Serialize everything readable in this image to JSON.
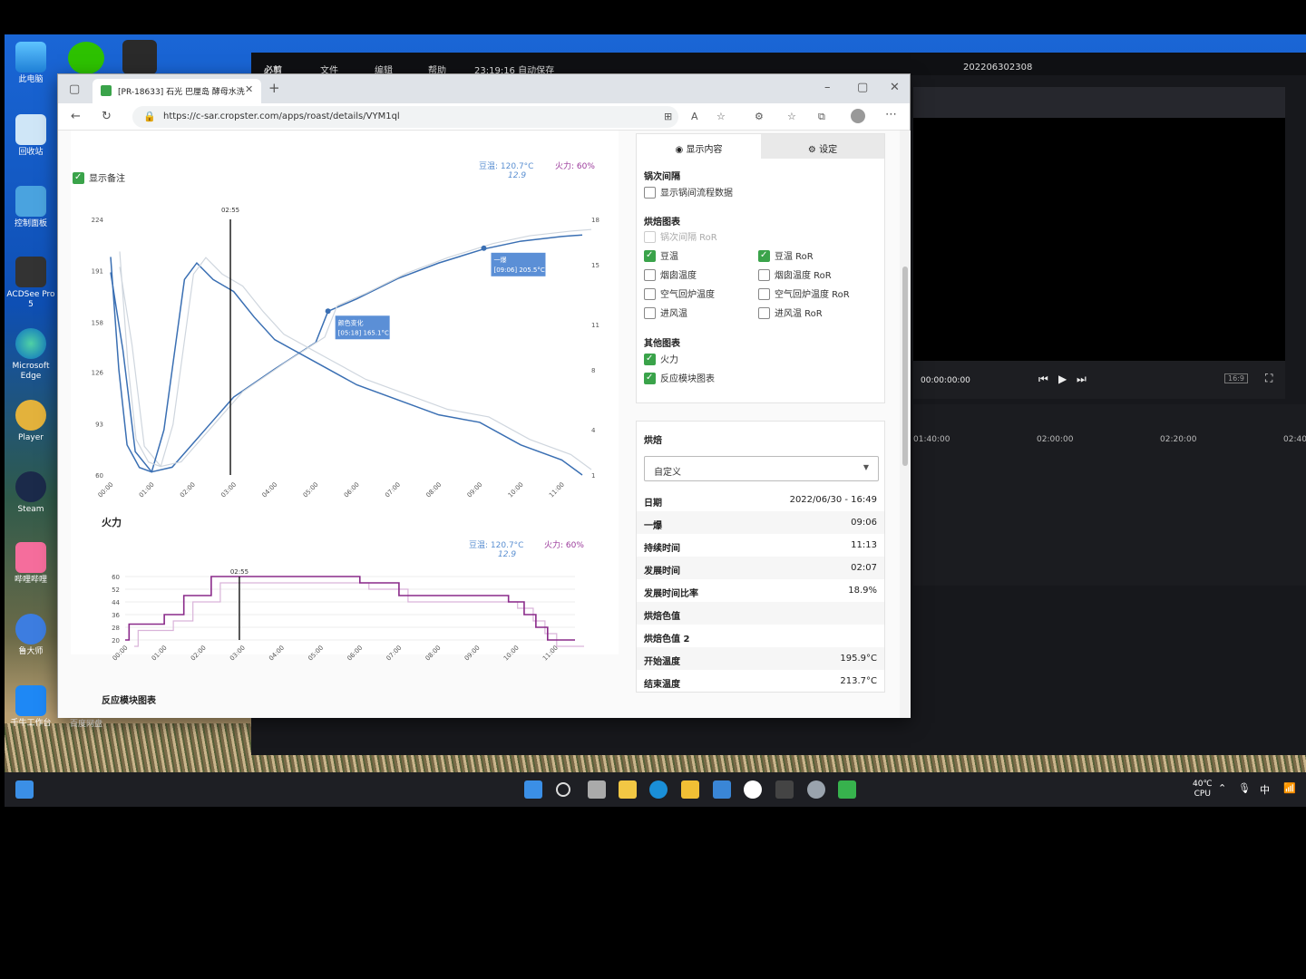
{
  "desktop": {
    "icons": [
      {
        "label": "此电脑"
      },
      {
        "label": "回收站"
      },
      {
        "label": "控制面板"
      },
      {
        "label": "ACDSee Pro 5"
      },
      {
        "label": "Microsoft Edge"
      },
      {
        "label": "Player"
      },
      {
        "label": "Steam"
      },
      {
        "label": "哔哩哔哩"
      },
      {
        "label": "鲁大师"
      },
      {
        "label": "千牛工作台"
      }
    ],
    "extra_label": "百度网盘"
  },
  "editor": {
    "app_name": "必剪",
    "menu": [
      "文件",
      "编辑",
      "帮助"
    ],
    "autosave": "23:19:16 自动保存",
    "project": "202206302308",
    "timecode": "00:00:00:00",
    "aspect": "16:9",
    "ruler": [
      "01:40:00",
      "02:00:00",
      "02:20:00",
      "02:40"
    ]
  },
  "browser": {
    "tab_title": "[PR-18633] 石光 巴厘岛 酵母水洗",
    "url": "https://c-sar.cropster.com/apps/roast/details/VYM1ql"
  },
  "chart_section": {
    "show_notes_label": "显示备注",
    "bt_label": "豆温:",
    "bt_value": "120.7°C",
    "ror_value": "12.9",
    "fire_label": "火力:",
    "fire_value": "60%",
    "fire_title": "火力",
    "reaction_title": "反应模块图表",
    "bt_label2": "豆温:",
    "bt_value2": "120.7°C",
    "ror_value2": "12.9",
    "fire_label2": "火力:",
    "fire_value2": "60%"
  },
  "chart_data": [
    {
      "type": "line",
      "cursor": "02:55",
      "x_ticks": [
        "00:00",
        "01:00",
        "02:00",
        "03:00",
        "04:00",
        "05:00",
        "06:00",
        "07:00",
        "08:00",
        "09:00",
        "10:00",
        "11:00"
      ],
      "y_left_ticks": [
        224,
        191,
        158,
        126,
        93,
        60
      ],
      "y_right_ticks": [
        18,
        15,
        11,
        8,
        4,
        1
      ],
      "ylim": [
        60,
        224
      ],
      "series": [
        {
          "name": "豆温",
          "color": "#3a6fb3",
          "x": [
            0,
            0.3,
            0.6,
            1.0,
            1.5,
            2.0,
            2.5,
            3.0,
            4.0,
            5.0,
            5.3,
            6.0,
            7.0,
            8.0,
            9.1,
            10.0,
            11.0,
            11.5
          ],
          "y": [
            190,
            140,
            75,
            62,
            65,
            80,
            95,
            110,
            128,
            145,
            165,
            173,
            186,
            196,
            205,
            210,
            213,
            214
          ]
        },
        {
          "name": "豆温 RoR",
          "color": "#3a6fb3",
          "axis": "right",
          "x": [
            0,
            0.2,
            0.4,
            0.7,
            1.0,
            1.3,
            1.6,
            1.8,
            2.1,
            2.5,
            3.0,
            3.5,
            4.0,
            5.0,
            6.0,
            7.0,
            8.0,
            9.0,
            10.0,
            11.0,
            11.5
          ],
          "y": [
            15.5,
            8,
            3,
            1.5,
            1.2,
            4,
            10,
            14,
            15.1,
            14,
            13.2,
            11.5,
            10,
            8.5,
            7,
            6,
            5,
            4.5,
            3,
            2,
            1
          ]
        }
      ],
      "annotations": [
        {
          "label": "颜色变化",
          "value": "[05:18] 165.1°C"
        },
        {
          "label": "一爆",
          "value": "[09:06] 205.5°C"
        }
      ]
    },
    {
      "type": "line",
      "cursor": "02:55",
      "x_ticks": [
        "00:00",
        "01:00",
        "02:00",
        "03:00",
        "04:00",
        "05:00",
        "06:00",
        "07:00",
        "08:00",
        "09:00",
        "10:00",
        "11:00"
      ],
      "y_ticks": [
        60,
        52,
        44,
        36,
        28,
        20
      ],
      "ylim": [
        20,
        60
      ],
      "series": [
        {
          "name": "火力",
          "color": "#8a2a8a",
          "x": [
            0,
            0.1,
            0.1,
            1.0,
            1.0,
            1.5,
            1.5,
            2.2,
            2.2,
            6.0,
            6.0,
            7.0,
            7.0,
            9.8,
            9.8,
            10.2,
            10.2,
            10.5,
            10.5,
            10.8,
            10.8,
            11.5
          ],
          "y": [
            20,
            20,
            30,
            30,
            36,
            36,
            48,
            48,
            60,
            60,
            56,
            56,
            48,
            48,
            44,
            44,
            36,
            36,
            28,
            28,
            20,
            20
          ]
        }
      ]
    }
  ],
  "settings": {
    "tab_display": "显示内容",
    "tab_settings": "设定",
    "batch_title": "锅次间隔",
    "batch_show": "显示锅间流程数据",
    "roast_title": "烘焙图表",
    "options": [
      {
        "label": "锅次间隔 RoR",
        "checked": false,
        "disabled": true
      },
      {
        "label": "豆温",
        "checked": true
      },
      {
        "label": "豆温 RoR",
        "checked": true
      },
      {
        "label": "烟囱温度",
        "checked": false
      },
      {
        "label": "烟囱温度 RoR",
        "checked": false
      },
      {
        "label": "空气回炉温度",
        "checked": false
      },
      {
        "label": "空气回炉温度 RoR",
        "checked": false
      },
      {
        "label": "进风温",
        "checked": false
      },
      {
        "label": "进风温 RoR",
        "checked": false
      }
    ],
    "other_title": "其他图表",
    "other_fire": "火力",
    "other_reaction": "反应模块图表"
  },
  "roast": {
    "title": "烘焙",
    "profile": "自定义",
    "rows": [
      {
        "key": "日期",
        "value": "2022/06/30 - 16:49"
      },
      {
        "key": "一爆",
        "value": "09:06"
      },
      {
        "key": "持续时间",
        "value": "11:13"
      },
      {
        "key": "发展时间",
        "value": "02:07"
      },
      {
        "key": "发展时间比率",
        "value": "18.9%"
      },
      {
        "key": "烘焙色值",
        "value": ""
      },
      {
        "key": "烘焙色值 2",
        "value": ""
      },
      {
        "key": "开始温度",
        "value": "195.9°C"
      },
      {
        "key": "结束温度",
        "value": "213.7°C"
      }
    ]
  },
  "taskbar": {
    "temp": "40℃",
    "cpu": "CPU",
    "ime": "中"
  }
}
